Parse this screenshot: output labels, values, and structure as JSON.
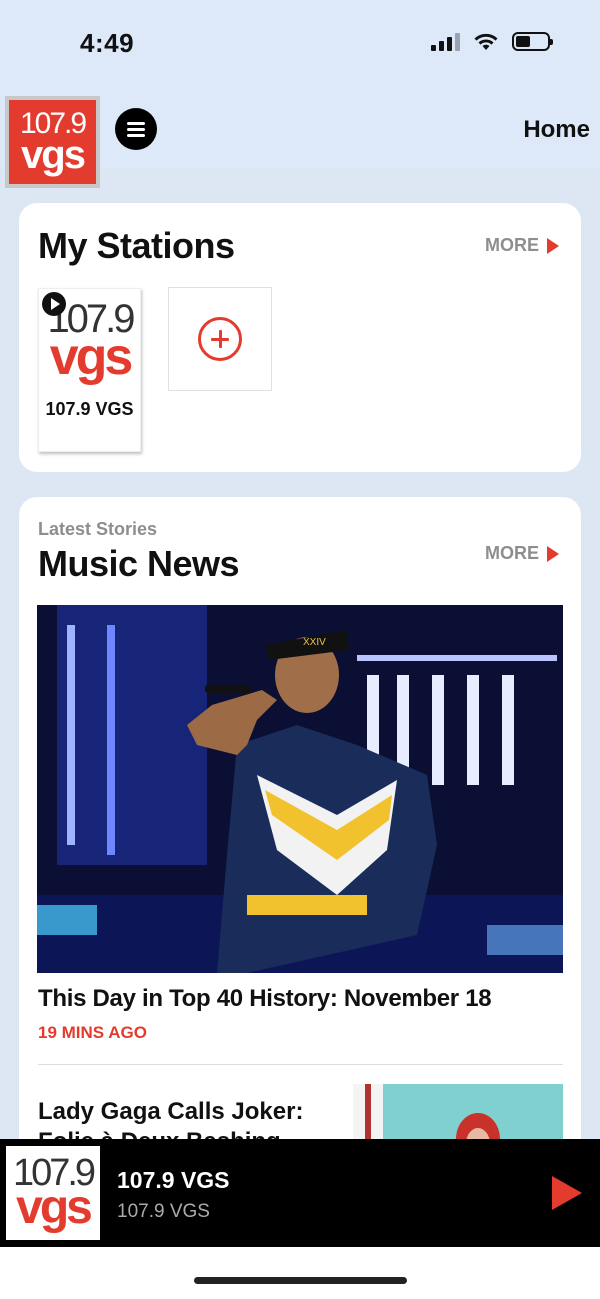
{
  "status_bar": {
    "time": "4:49"
  },
  "header": {
    "logo_number": "107.9",
    "logo_letters": "vgs",
    "home_label": "Home"
  },
  "my_stations": {
    "title": "My Stations",
    "more_label": "MORE",
    "stations": [
      {
        "logo_number": "107.9",
        "logo_letters": "vgs",
        "label": "107.9 VGS"
      }
    ]
  },
  "music_news": {
    "kicker": "Latest Stories",
    "title": "Music News",
    "more_label": "MORE",
    "articles": [
      {
        "title": "This Day in Top 40 History: November 18",
        "time": "19 MINS AGO",
        "hat_text": "XXIV"
      },
      {
        "title": "Lady Gaga Calls Joker: Folie à Deux Bashing"
      }
    ]
  },
  "now_playing": {
    "logo_number": "107.9",
    "logo_letters": "vgs",
    "title": "107.9 VGS",
    "subtitle": "107.9 VGS"
  },
  "colors": {
    "accent": "#e33b2e",
    "background": "#dde7f4",
    "player_background": "#000000"
  }
}
